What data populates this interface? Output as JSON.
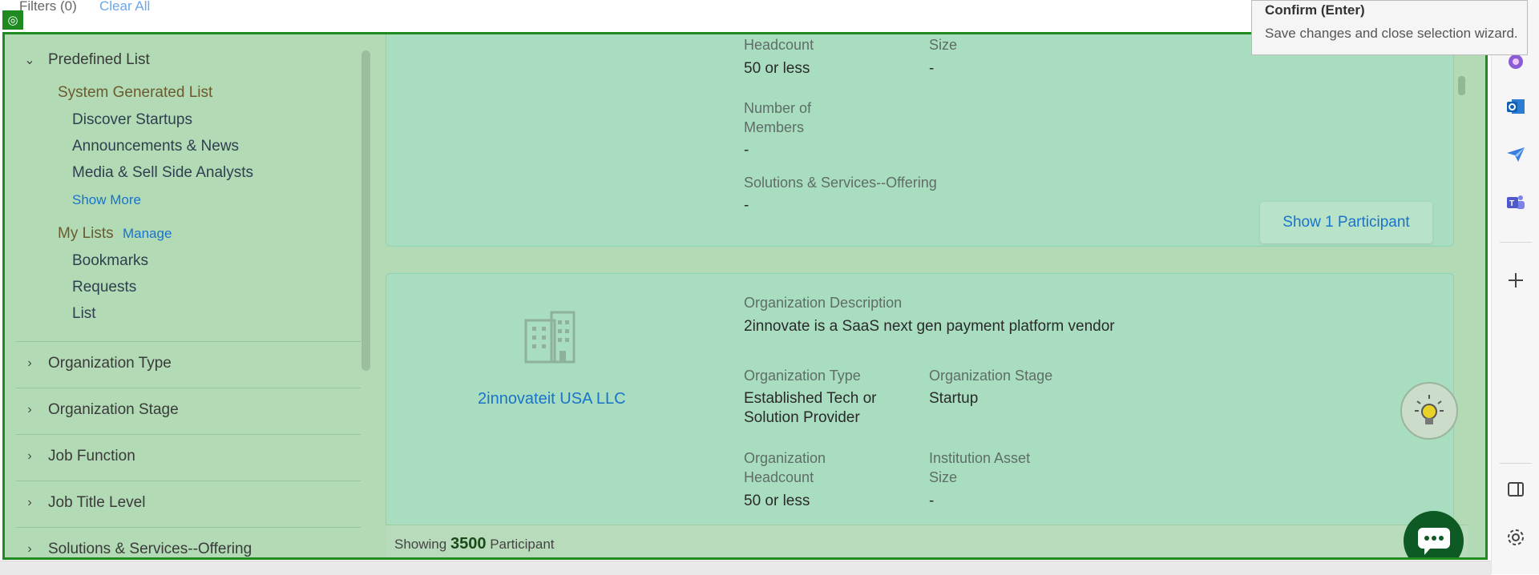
{
  "topbar": {
    "filters_label": "Filters (0)",
    "clear_all": "Clear All"
  },
  "tooltip": {
    "title": "Confirm (Enter)",
    "desc": "Save changes and close selection wizard."
  },
  "sidebar": {
    "predefined": "Predefined List",
    "system_generated": "System Generated List",
    "system_items": [
      "Discover Startups",
      "Announcements & News",
      "Media & Sell Side Analysts"
    ],
    "show_more": "Show More",
    "my_lists": "My Lists",
    "manage": "Manage",
    "my_items": [
      "Bookmarks",
      "Requests",
      "List"
    ],
    "sections": [
      "Organization Type",
      "Organization Stage",
      "Job Function",
      "Job Title Level",
      "Solutions & Services--Offering"
    ]
  },
  "card1": {
    "headcount_label": "Headcount",
    "size_label": "Size",
    "headcount_value": "50 or less",
    "size_value": "-",
    "members_label": "Number of Members",
    "members_value": "-",
    "solutions_label": "Solutions & Services--Offering",
    "solutions_value": "-",
    "show_button": "Show 1 Participant"
  },
  "card2": {
    "org_name": "2innovateit USA LLC",
    "desc_label": "Organization Description",
    "desc_value": "2innovate is a SaaS next gen payment platform vendor",
    "type_label": "Organization Type",
    "type_value": "Established Tech or Solution Provider",
    "stage_label": "Organization Stage",
    "stage_value": "Startup",
    "headcount_label": "Organization Headcount",
    "headcount_value": "50 or less",
    "asset_label": "Institution Asset Size",
    "asset_value": "-"
  },
  "footer": {
    "showing": "Showing",
    "count": "3500",
    "unit": "Participant"
  },
  "colors": {
    "overlay": "#b2dbb5",
    "border": "#1f8a1f",
    "link": "#1a73c9",
    "chat": "#0e5a24"
  }
}
